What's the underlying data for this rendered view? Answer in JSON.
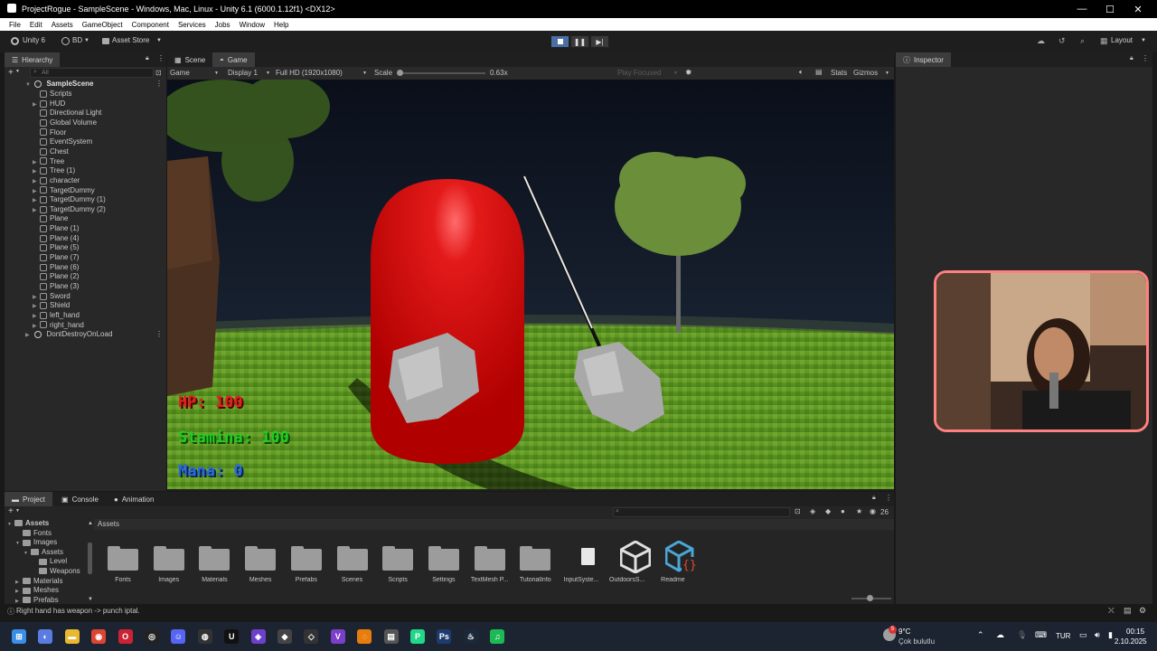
{
  "window": {
    "title": "ProjectRogue - SampleScene - Windows, Mac, Linux - Unity 6.1 (6000.1.12f1) <DX12>",
    "minimize": "—",
    "maximize": "☐",
    "close": "✕"
  },
  "menu": [
    "File",
    "Edit",
    "Assets",
    "GameObject",
    "Component",
    "Services",
    "Jobs",
    "Window",
    "Help"
  ],
  "toolbar": {
    "unity_label": "Unity 6",
    "account": "BD",
    "asset_store": "Asset Store",
    "layout": "Layout"
  },
  "hierarchy": {
    "tab": "Hierarchy",
    "search_placeholder": "All",
    "scene": "SampleScene",
    "items": [
      {
        "label": "Scripts",
        "arrow": ""
      },
      {
        "label": "HUD",
        "arrow": "▶"
      },
      {
        "label": "Directional Light",
        "arrow": ""
      },
      {
        "label": "Global Volume",
        "arrow": ""
      },
      {
        "label": "Floor",
        "arrow": ""
      },
      {
        "label": "EventSystem",
        "arrow": ""
      },
      {
        "label": "Chest",
        "arrow": ""
      },
      {
        "label": "Tree",
        "arrow": "▶"
      },
      {
        "label": "Tree (1)",
        "arrow": "▶"
      },
      {
        "label": "character",
        "arrow": "▶"
      },
      {
        "label": "TargetDummy",
        "arrow": "▶"
      },
      {
        "label": "TargetDummy (1)",
        "arrow": "▶"
      },
      {
        "label": "TargetDummy (2)",
        "arrow": "▶"
      },
      {
        "label": "Plane",
        "arrow": ""
      },
      {
        "label": "Plane (1)",
        "arrow": ""
      },
      {
        "label": "Plane (4)",
        "arrow": ""
      },
      {
        "label": "Plane (5)",
        "arrow": ""
      },
      {
        "label": "Plane (7)",
        "arrow": ""
      },
      {
        "label": "Plane (6)",
        "arrow": ""
      },
      {
        "label": "Plane (2)",
        "arrow": ""
      },
      {
        "label": "Plane (3)",
        "arrow": ""
      },
      {
        "label": "Sword",
        "arrow": "▶"
      },
      {
        "label": "Shield",
        "arrow": "▶"
      },
      {
        "label": "left_hand",
        "arrow": "▶"
      },
      {
        "label": "right_hand",
        "arrow": "▶"
      }
    ],
    "dont_destroy": "DontDestroyOnLoad"
  },
  "scene_tabs": {
    "scene": "Scene",
    "game": "Game"
  },
  "game_toolbar": {
    "mode": "Game",
    "display": "Display 1",
    "resolution": "Full HD (1920x1080)",
    "scale_label": "Scale",
    "scale_value": "0.63x",
    "play_focused": "Play Focused",
    "stats": "Stats",
    "gizmos": "Gizmos"
  },
  "hud": {
    "hp": "HP: 100",
    "stamina": "Stamina: 100",
    "mana": "Mana: 0"
  },
  "inspector": {
    "tab": "Inspector"
  },
  "project": {
    "tabs": [
      "Project",
      "Console",
      "Animation"
    ],
    "breadcrumb": "Assets",
    "count": "26",
    "tree": [
      {
        "label": "Assets",
        "indent": 0,
        "arrow": "▼"
      },
      {
        "label": "Fonts",
        "indent": 1,
        "arrow": ""
      },
      {
        "label": "Images",
        "indent": 1,
        "arrow": "▼"
      },
      {
        "label": "Assets",
        "indent": 2,
        "arrow": "▼"
      },
      {
        "label": "Level",
        "indent": 3,
        "arrow": ""
      },
      {
        "label": "Weapons",
        "indent": 3,
        "arrow": ""
      },
      {
        "label": "Materials",
        "indent": 1,
        "arrow": "▶"
      },
      {
        "label": "Meshes",
        "indent": 1,
        "arrow": "▶"
      },
      {
        "label": "Prefabs",
        "indent": 1,
        "arrow": "▶"
      }
    ],
    "assets": [
      {
        "label": "Fonts",
        "kind": "folder"
      },
      {
        "label": "Images",
        "kind": "folder"
      },
      {
        "label": "Materials",
        "kind": "folder"
      },
      {
        "label": "Meshes",
        "kind": "folder"
      },
      {
        "label": "Prefabs",
        "kind": "folder"
      },
      {
        "label": "Scenes",
        "kind": "folder"
      },
      {
        "label": "Scripts",
        "kind": "folder"
      },
      {
        "label": "Settings",
        "kind": "folder"
      },
      {
        "label": "TextMesh P...",
        "kind": "folder"
      },
      {
        "label": "TutorialInfo",
        "kind": "folder"
      },
      {
        "label": "InputSyste...",
        "kind": "file"
      },
      {
        "label": "OutdoorsS...",
        "kind": "unity"
      },
      {
        "label": "Readme",
        "kind": "readme"
      }
    ]
  },
  "status": "Right hand has weapon -> punch iptal.",
  "taskbar": {
    "weather_temp": "9°C",
    "weather_desc": "Çok bulutlu",
    "lang": "TUR",
    "time": "00:15",
    "date": "2.10.2025",
    "weather_badge": "5"
  }
}
